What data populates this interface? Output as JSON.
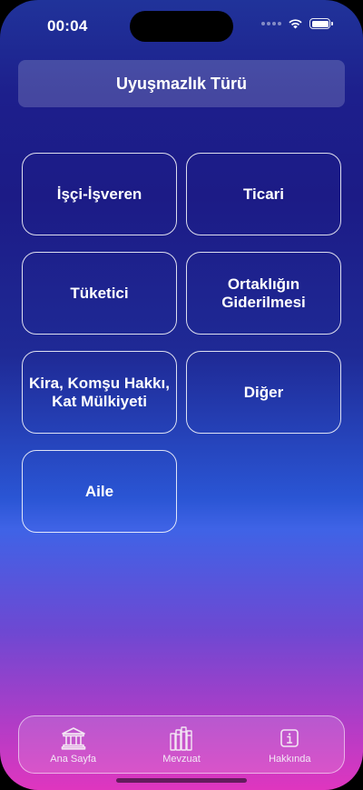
{
  "status_bar": {
    "time": "00:04"
  },
  "header": {
    "title": "Uyuşmazlık Türü"
  },
  "categories": [
    {
      "label": "İşçi-İşveren"
    },
    {
      "label": "Ticari"
    },
    {
      "label": "Tüketici"
    },
    {
      "label": "Ortaklığın\nGiderilmesi"
    },
    {
      "label": "Kira, Komşu Hakkı,\nKat Mülkiyeti"
    },
    {
      "label": "Diğer"
    },
    {
      "label": "Aile"
    }
  ],
  "tab_bar": {
    "items": [
      {
        "label": "Ana Sayfa",
        "icon": "courthouse-icon"
      },
      {
        "label": "Mevzuat",
        "icon": "books-icon"
      },
      {
        "label": "Hakkında",
        "icon": "info-icon"
      }
    ]
  },
  "colors": {
    "gradient_top": "#20339a",
    "gradient_mid": "#2a55d4",
    "gradient_bottom": "#df36bf"
  }
}
